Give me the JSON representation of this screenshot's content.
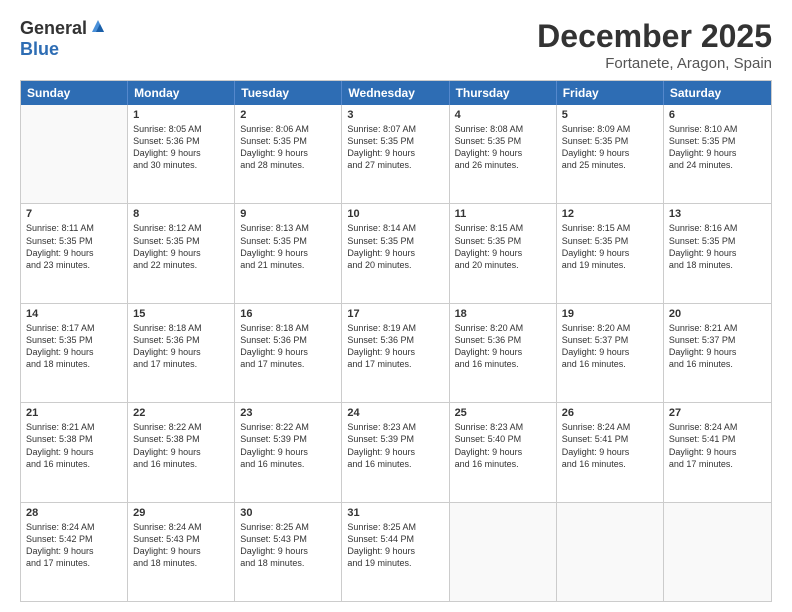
{
  "header": {
    "logo_general": "General",
    "logo_blue": "Blue",
    "month_title": "December 2025",
    "location": "Fortanete, Aragon, Spain"
  },
  "weekdays": [
    "Sunday",
    "Monday",
    "Tuesday",
    "Wednesday",
    "Thursday",
    "Friday",
    "Saturday"
  ],
  "weeks": [
    [
      {
        "day": "",
        "info": ""
      },
      {
        "day": "1",
        "info": "Sunrise: 8:05 AM\nSunset: 5:36 PM\nDaylight: 9 hours\nand 30 minutes."
      },
      {
        "day": "2",
        "info": "Sunrise: 8:06 AM\nSunset: 5:35 PM\nDaylight: 9 hours\nand 28 minutes."
      },
      {
        "day": "3",
        "info": "Sunrise: 8:07 AM\nSunset: 5:35 PM\nDaylight: 9 hours\nand 27 minutes."
      },
      {
        "day": "4",
        "info": "Sunrise: 8:08 AM\nSunset: 5:35 PM\nDaylight: 9 hours\nand 26 minutes."
      },
      {
        "day": "5",
        "info": "Sunrise: 8:09 AM\nSunset: 5:35 PM\nDaylight: 9 hours\nand 25 minutes."
      },
      {
        "day": "6",
        "info": "Sunrise: 8:10 AM\nSunset: 5:35 PM\nDaylight: 9 hours\nand 24 minutes."
      }
    ],
    [
      {
        "day": "7",
        "info": "Sunrise: 8:11 AM\nSunset: 5:35 PM\nDaylight: 9 hours\nand 23 minutes."
      },
      {
        "day": "8",
        "info": "Sunrise: 8:12 AM\nSunset: 5:35 PM\nDaylight: 9 hours\nand 22 minutes."
      },
      {
        "day": "9",
        "info": "Sunrise: 8:13 AM\nSunset: 5:35 PM\nDaylight: 9 hours\nand 21 minutes."
      },
      {
        "day": "10",
        "info": "Sunrise: 8:14 AM\nSunset: 5:35 PM\nDaylight: 9 hours\nand 20 minutes."
      },
      {
        "day": "11",
        "info": "Sunrise: 8:15 AM\nSunset: 5:35 PM\nDaylight: 9 hours\nand 20 minutes."
      },
      {
        "day": "12",
        "info": "Sunrise: 8:15 AM\nSunset: 5:35 PM\nDaylight: 9 hours\nand 19 minutes."
      },
      {
        "day": "13",
        "info": "Sunrise: 8:16 AM\nSunset: 5:35 PM\nDaylight: 9 hours\nand 18 minutes."
      }
    ],
    [
      {
        "day": "14",
        "info": "Sunrise: 8:17 AM\nSunset: 5:35 PM\nDaylight: 9 hours\nand 18 minutes."
      },
      {
        "day": "15",
        "info": "Sunrise: 8:18 AM\nSunset: 5:36 PM\nDaylight: 9 hours\nand 17 minutes."
      },
      {
        "day": "16",
        "info": "Sunrise: 8:18 AM\nSunset: 5:36 PM\nDaylight: 9 hours\nand 17 minutes."
      },
      {
        "day": "17",
        "info": "Sunrise: 8:19 AM\nSunset: 5:36 PM\nDaylight: 9 hours\nand 17 minutes."
      },
      {
        "day": "18",
        "info": "Sunrise: 8:20 AM\nSunset: 5:36 PM\nDaylight: 9 hours\nand 16 minutes."
      },
      {
        "day": "19",
        "info": "Sunrise: 8:20 AM\nSunset: 5:37 PM\nDaylight: 9 hours\nand 16 minutes."
      },
      {
        "day": "20",
        "info": "Sunrise: 8:21 AM\nSunset: 5:37 PM\nDaylight: 9 hours\nand 16 minutes."
      }
    ],
    [
      {
        "day": "21",
        "info": "Sunrise: 8:21 AM\nSunset: 5:38 PM\nDaylight: 9 hours\nand 16 minutes."
      },
      {
        "day": "22",
        "info": "Sunrise: 8:22 AM\nSunset: 5:38 PM\nDaylight: 9 hours\nand 16 minutes."
      },
      {
        "day": "23",
        "info": "Sunrise: 8:22 AM\nSunset: 5:39 PM\nDaylight: 9 hours\nand 16 minutes."
      },
      {
        "day": "24",
        "info": "Sunrise: 8:23 AM\nSunset: 5:39 PM\nDaylight: 9 hours\nand 16 minutes."
      },
      {
        "day": "25",
        "info": "Sunrise: 8:23 AM\nSunset: 5:40 PM\nDaylight: 9 hours\nand 16 minutes."
      },
      {
        "day": "26",
        "info": "Sunrise: 8:24 AM\nSunset: 5:41 PM\nDaylight: 9 hours\nand 16 minutes."
      },
      {
        "day": "27",
        "info": "Sunrise: 8:24 AM\nSunset: 5:41 PM\nDaylight: 9 hours\nand 17 minutes."
      }
    ],
    [
      {
        "day": "28",
        "info": "Sunrise: 8:24 AM\nSunset: 5:42 PM\nDaylight: 9 hours\nand 17 minutes."
      },
      {
        "day": "29",
        "info": "Sunrise: 8:24 AM\nSunset: 5:43 PM\nDaylight: 9 hours\nand 18 minutes."
      },
      {
        "day": "30",
        "info": "Sunrise: 8:25 AM\nSunset: 5:43 PM\nDaylight: 9 hours\nand 18 minutes."
      },
      {
        "day": "31",
        "info": "Sunrise: 8:25 AM\nSunset: 5:44 PM\nDaylight: 9 hours\nand 19 minutes."
      },
      {
        "day": "",
        "info": ""
      },
      {
        "day": "",
        "info": ""
      },
      {
        "day": "",
        "info": ""
      }
    ]
  ]
}
